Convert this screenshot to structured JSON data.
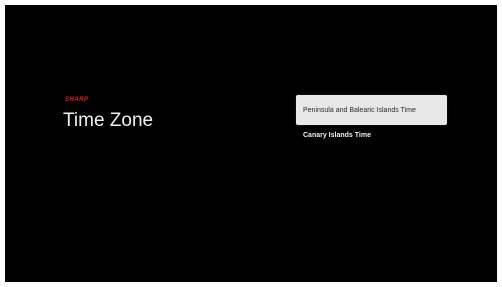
{
  "brand": {
    "logo_text": "SHARP",
    "color": "#e2231a"
  },
  "page": {
    "title": "Time Zone"
  },
  "time_zones": [
    {
      "label": "Peninsula and Balearic Islands Time",
      "selected": true
    },
    {
      "label": "Canary Islands Time",
      "selected": false
    }
  ],
  "colors": {
    "background": "#000000",
    "selected_bg": "#e8e8e8",
    "text": "#eeeeee"
  }
}
